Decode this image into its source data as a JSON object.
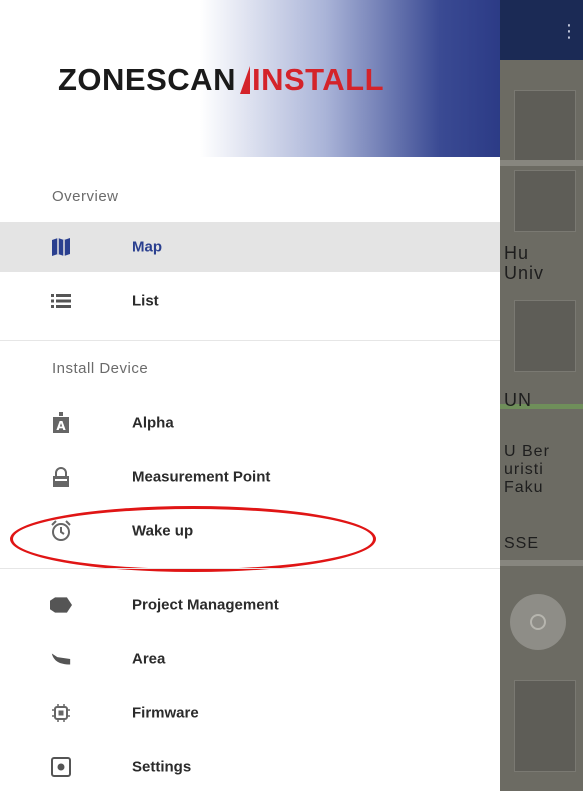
{
  "header": {
    "logo_primary": "ZONESCAN",
    "logo_secondary": "INSTALL"
  },
  "sections": {
    "overview": "Overview",
    "install_device": "Install Device"
  },
  "items": {
    "map": {
      "label": "Map",
      "icon": "map-icon"
    },
    "list": {
      "label": "List",
      "icon": "list-icon"
    },
    "alpha": {
      "label": "Alpha",
      "icon": "alpha-device-icon"
    },
    "measurement_point": {
      "label": "Measurement Point",
      "icon": "lock-icon"
    },
    "wake_up": {
      "label": "Wake up",
      "icon": "alarm-clock-icon"
    },
    "project_management": {
      "label": "Project Management",
      "icon": "folder-tag-icon"
    },
    "area": {
      "label": "Area",
      "icon": "area-icon"
    },
    "firmware": {
      "label": "Firmware",
      "icon": "chip-icon"
    },
    "settings": {
      "label": "Settings",
      "icon": "settings-icon"
    }
  },
  "map_labels": {
    "line1": "Hu",
    "line2": "Univ",
    "line3": "UN",
    "line4": "U Ber",
    "line5": "uristi",
    "line6": "Faku",
    "line7": "SSE"
  },
  "colors": {
    "accent_blue": "#2a3f8f",
    "logo_red": "#d4232a",
    "highlight_red": "#e01515",
    "active_bg": "#e4e4e4"
  }
}
